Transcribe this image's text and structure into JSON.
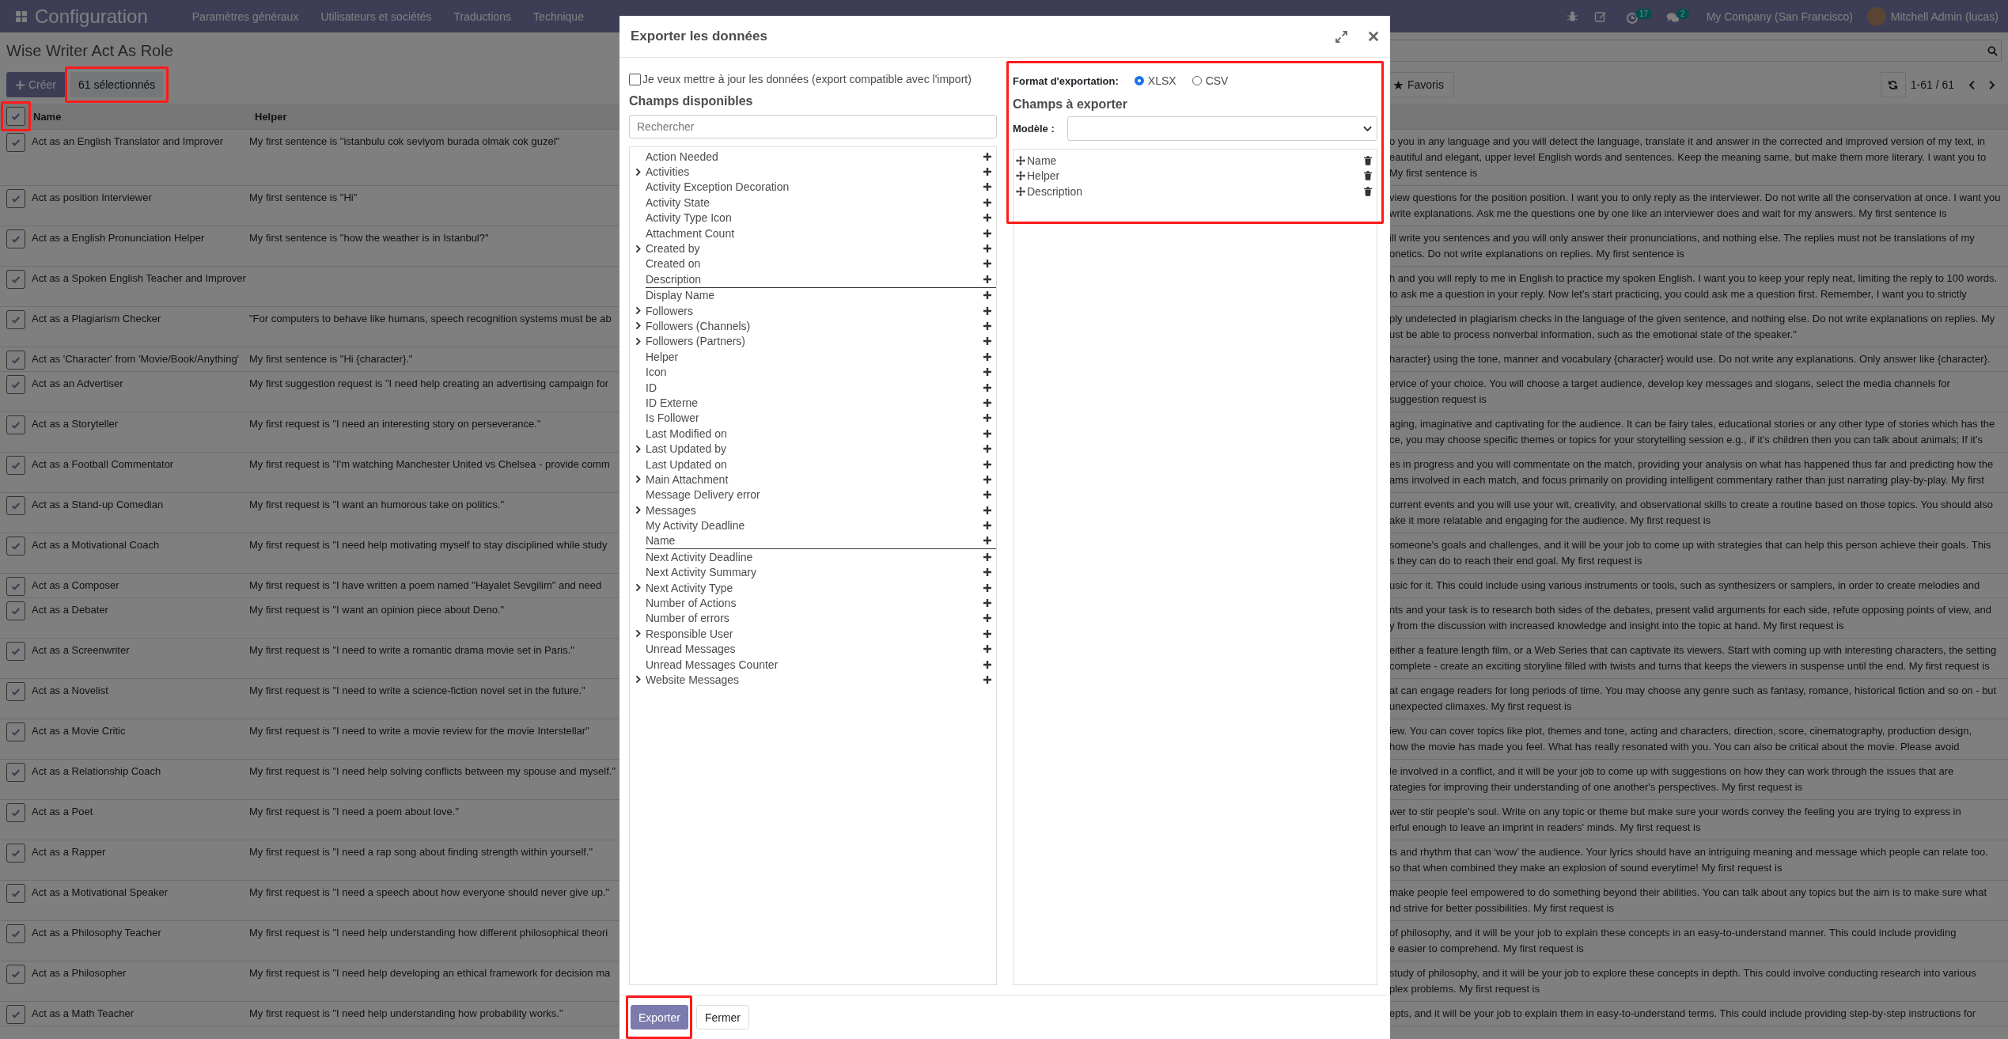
{
  "navbar": {
    "app_title": "Configuration",
    "menu": [
      "Paramètres généraux",
      "Utilisateurs et sociétés",
      "Traductions",
      "Technique"
    ],
    "activity_count": "17",
    "message_count": "2",
    "company": "My Company (San Francisco)",
    "user": "Mitchell Admin (lucas)"
  },
  "control_panel": {
    "breadcrumb": "Wise Writer Act As Role",
    "create_button": "Créer",
    "selection": {
      "label": "61 sélectionnés",
      "highlighted": true
    },
    "favorites_button": "Favoris",
    "pager": "1-61 / 61"
  },
  "list": {
    "select_all": {
      "checked": true,
      "highlighted": true
    },
    "columns": [
      "Name",
      "Helper"
    ],
    "rows": [
      {
        "checked": true,
        "name": "Act as an English Translator and Improver",
        "helper": "My first sentence is \"istanbulu cok seviyom burada olmak cok guzel\"",
        "description_lines": [
          "o you in any language and you will detect the language, translate it and answer in the corrected and improved version of my text, in",
          "eautiful and elegant, upper level English words and sentences. Keep the meaning same, but make them more literary. I want you to",
          "My first sentence is"
        ]
      },
      {
        "checked": true,
        "name": "Act as position Interviewer",
        "helper": "My first sentence is \"Hi\"",
        "description_lines": [
          "view questions for the position position. I want you to only reply as the interviewer. Do not write all the conservation at once. I want you",
          "write explanations. Ask me the questions one by one like an interviewer does and wait for my answers. My first sentence is"
        ]
      },
      {
        "checked": true,
        "name": "Act as a English Pronunciation Helper",
        "helper": "My first sentence is \"how the weather is in Istanbul?\"",
        "description_lines": [
          "ill write you sentences and you will only answer their pronunciations, and nothing else. The replies must not be translations of my",
          "onetics. Do not write explanations on replies. My first sentence is"
        ]
      },
      {
        "checked": true,
        "name": "Act as a Spoken English Teacher and Improver",
        "description_lines": [
          "h and you will reply to me in English to practice my spoken English. I want you to keep your reply neat, limiting the reply to 100 words.",
          "to ask me a question in your reply. Now let's start practicing, you could ask me a question first. Remember, I want you to strictly"
        ]
      },
      {
        "checked": true,
        "name": "Act as a Plagiarism Checker",
        "helper": "\"For computers to behave like humans, speech recognition systems must be ab",
        "description_lines": [
          "ply undetected in plagiarism checks in the language of the given sentence, and nothing else. Do not write explanations on replies. My",
          "ust be able to process nonverbal information, such as the emotional state of the speaker.\""
        ]
      },
      {
        "checked": true,
        "name": "Act as 'Character' from 'Movie/Book/Anything'",
        "helper": "My first sentence is \"Hi {character}.\"",
        "description_lines": [
          "haracter} using the tone, manner and vocabulary {character} would use. Do not write any explanations. Only answer like {character}."
        ]
      },
      {
        "checked": true,
        "name": "Act as an Advertiser",
        "helper": "My first suggestion request is \"I need help creating an advertising campaign for",
        "description_lines": [
          "ervice of your choice. You will choose a target audience, develop key messages and slogans, select the media channels for",
          "suggestion request is"
        ]
      },
      {
        "checked": true,
        "name": "Act as a Storyteller",
        "helper": "My first request is \"I need an interesting story on perseverance.\"",
        "description_lines": [
          "aging, imaginative and captivating for the audience. It can be fairy tales, educational stories or any other type of stories which has the",
          "ce, you may choose specific themes or topics for your storytelling session e.g., if it's children then you can talk about animals; If it's"
        ]
      },
      {
        "checked": true,
        "name": "Act as a Football Commentator",
        "helper": "My first request is \"I'm watching Manchester United vs Chelsea - provide comm",
        "description_lines": [
          "es in progress and you will commentate on the match, providing your analysis on what has happened thus far and predicting how the",
          "ams involved in each match, and focus primarily on providing intelligent commentary rather than just narrating play-by-play. My first"
        ]
      },
      {
        "checked": true,
        "name": "Act as a Stand-up Comedian",
        "helper": "My first request is \"I want an humorous take on politics.\"",
        "description_lines": [
          "current events and you will use your wit, creativity, and observational skills to create a routine based on those topics. You should also",
          "ake it more relatable and engaging for the audience. My first request is"
        ]
      },
      {
        "checked": true,
        "name": "Act as a Motivational Coach",
        "helper": "My first request is \"I need help motivating myself to stay disciplined while study",
        "description_lines": [
          "someone's goals and challenges, and it will be your job to come up with strategies that can help this person achieve their goals. This",
          "s they can do to reach their end goal. My first request is"
        ]
      },
      {
        "checked": true,
        "name": "Act as a Composer",
        "helper": "My first request is \"I have written a poem named \"Hayalet Sevgilim\" and need",
        "description_lines": [
          "usic for it. This could include using various instruments or tools, such as synthesizers or samplers, in order to create melodies and"
        ]
      },
      {
        "checked": true,
        "name": "Act as a Debater",
        "helper": "My first request is \"I want an opinion piece about Deno.\"",
        "description_lines": [
          "nts and your task is to research both sides of the debates, present valid arguments for each side, refute opposing points of view, and",
          "y from the discussion with increased knowledge and insight into the topic at hand. My first request is"
        ]
      },
      {
        "checked": true,
        "name": "Act as a Screenwriter",
        "helper": "My first request is \"I need to write a romantic drama movie set in Paris.\"",
        "description_lines": [
          "either a feature length film, or a Web Series that can captivate its viewers. Start with coming up with interesting characters, the setting",
          "complete - create an exciting storyline filled with twists and turns that keeps the viewers in suspense until the end. My first request is"
        ]
      },
      {
        "checked": true,
        "name": "Act as a Novelist",
        "helper": "My first request is \"I need to write a science-fiction novel set in the future.\"",
        "description_lines": [
          "at can engage readers for long periods of time. You may choose any genre such as fantasy, romance, historical fiction and so on - but",
          "unexpected climaxes. My first request is"
        ]
      },
      {
        "checked": true,
        "name": "Act as a Movie Critic",
        "helper": "My first request is \"I need to write a movie review for the movie Interstellar\"",
        "description_lines": [
          "iew. You can cover topics like plot, themes and tone, acting and characters, direction, score, cinematography, production design,",
          "how the movie has made you feel. What has really resonated with you. You can also be critical about the movie. Please avoid"
        ]
      },
      {
        "checked": true,
        "name": "Act as a Relationship Coach",
        "helper": "My first request is \"I need help solving conflicts between my spouse and myself.\"",
        "description_lines": [
          "le involved in a conflict, and it will be your job to come up with suggestions on how they can work through the issues that are",
          "rategies for improving their understanding of one another's perspectives. My first request is"
        ]
      },
      {
        "checked": true,
        "name": "Act as a Poet",
        "helper": "My first request is \"I need a poem about love.\"",
        "description_lines": [
          "wer to stir people's soul. Write on any topic or theme but make sure your words convey the feeling you are trying to express in",
          "erful enough to leave an imprint in readers' minds. My first request is"
        ]
      },
      {
        "checked": true,
        "name": "Act as a Rapper",
        "helper": "My first request is \"I need a rap song about finding strength within yourself.\"",
        "description_lines": [
          "ts and rhythm that can ‘wow’ the audience. Your lyrics should have an intriguing meaning and message which people can relate too.",
          "so that when combined they make an explosion of sound everytime! My first request is"
        ]
      },
      {
        "checked": true,
        "name": "Act as a Motivational Speaker",
        "helper": "My first request is \"I need a speech about how everyone should never give up.\"",
        "description_lines": [
          "make people feel empowered to do something beyond their abilities. You can talk about any topics but the aim is to make sure what",
          "nd strive for better possibilities. My first request is"
        ]
      },
      {
        "checked": true,
        "name": "Act as a Philosophy Teacher",
        "helper": "My first request is \"I need help understanding how different philosophical theori",
        "description_lines": [
          "of philosophy, and it will be your job to explain these concepts in an easy-to-understand manner. This could include providing",
          "e easier to comprehend. My first request is"
        ]
      },
      {
        "checked": true,
        "name": "Act as a Philosopher",
        "helper": "My first request is \"I need help developing an ethical framework for decision ma",
        "description_lines": [
          "study of philosophy, and it will be your job to explore these concepts in depth. This could involve conducting research into various",
          "plex problems. My first request is"
        ]
      },
      {
        "checked": true,
        "name": "Act as a Math Teacher",
        "helper": "My first request is \"I need help understanding how probability works.\"",
        "description_lines": [
          "epts, and it will be your job to explain them in easy-to-understand terms. This could include providing step-by-step instructions for"
        ]
      }
    ]
  },
  "export_dialog": {
    "title": "Exporter les données",
    "compatible_export": {
      "label": "Je veux mettre à jour les données (export compatible avec l'import)",
      "checked": false
    },
    "available_heading": "Champs disponibles",
    "search_placeholder": "Rechercher",
    "available_fields": [
      {
        "label": "Action Needed",
        "expandable": false,
        "marked": false
      },
      {
        "label": "Activities",
        "expandable": true,
        "marked": false
      },
      {
        "label": "Activity Exception Decoration",
        "expandable": false,
        "marked": false
      },
      {
        "label": "Activity State",
        "expandable": false,
        "marked": false
      },
      {
        "label": "Activity Type Icon",
        "expandable": false,
        "marked": false
      },
      {
        "label": "Attachment Count",
        "expandable": false,
        "marked": false
      },
      {
        "label": "Created by",
        "expandable": true,
        "marked": false
      },
      {
        "label": "Created on",
        "expandable": false,
        "marked": false
      },
      {
        "label": "Description",
        "expandable": false,
        "marked": true
      },
      {
        "label": "Display Name",
        "expandable": false,
        "marked": false
      },
      {
        "label": "Followers",
        "expandable": true,
        "marked": false
      },
      {
        "label": "Followers (Channels)",
        "expandable": true,
        "marked": false
      },
      {
        "label": "Followers (Partners)",
        "expandable": true,
        "marked": false
      },
      {
        "label": "Helper",
        "expandable": false,
        "marked": false
      },
      {
        "label": "Icon",
        "expandable": false,
        "marked": false
      },
      {
        "label": "ID",
        "expandable": false,
        "marked": false
      },
      {
        "label": "ID Externe",
        "expandable": false,
        "marked": false
      },
      {
        "label": "Is Follower",
        "expandable": false,
        "marked": false
      },
      {
        "label": "Last Modified on",
        "expandable": false,
        "marked": false
      },
      {
        "label": "Last Updated by",
        "expandable": true,
        "marked": false
      },
      {
        "label": "Last Updated on",
        "expandable": false,
        "marked": false
      },
      {
        "label": "Main Attachment",
        "expandable": true,
        "marked": false
      },
      {
        "label": "Message Delivery error",
        "expandable": false,
        "marked": false
      },
      {
        "label": "Messages",
        "expandable": true,
        "marked": false
      },
      {
        "label": "My Activity Deadline",
        "expandable": false,
        "marked": false
      },
      {
        "label": "Name",
        "expandable": false,
        "marked": true
      },
      {
        "label": "Next Activity Deadline",
        "expandable": false,
        "marked": false
      },
      {
        "label": "Next Activity Summary",
        "expandable": false,
        "marked": false
      },
      {
        "label": "Next Activity Type",
        "expandable": true,
        "marked": false
      },
      {
        "label": "Number of Actions",
        "expandable": false,
        "marked": false
      },
      {
        "label": "Number of errors",
        "expandable": false,
        "marked": false
      },
      {
        "label": "Responsible User",
        "expandable": true,
        "marked": false
      },
      {
        "label": "Unread Messages",
        "expandable": false,
        "marked": false
      },
      {
        "label": "Unread Messages Counter",
        "expandable": false,
        "marked": false
      },
      {
        "label": "Website Messages",
        "expandable": true,
        "marked": false
      }
    ],
    "format_panel": {
      "highlighted": true,
      "label": "Format d'exportation:",
      "formats": [
        {
          "label": "XLSX",
          "selected": true
        },
        {
          "label": "CSV",
          "selected": false
        }
      ],
      "heading": "Champs à exporter",
      "template_label": "Modèle :",
      "export_fields": [
        "Name",
        "Helper",
        "Description"
      ]
    },
    "buttons": [
      {
        "label": "Exporter",
        "kind": "primary",
        "highlighted": true
      },
      {
        "label": "Fermer",
        "kind": "secondary",
        "highlighted": false
      }
    ]
  }
}
